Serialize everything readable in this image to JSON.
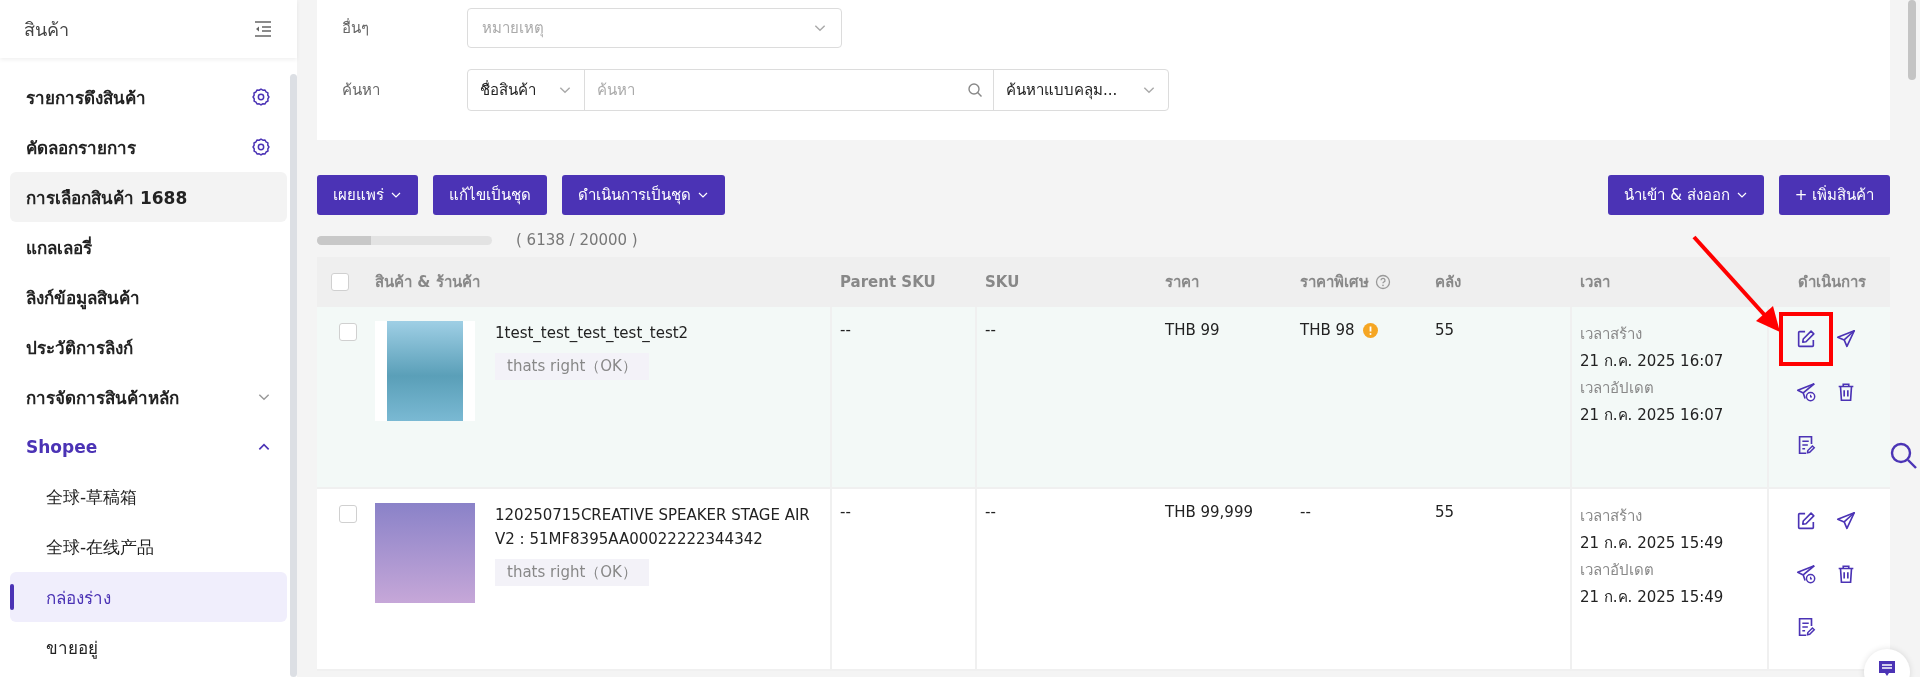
{
  "sidebar": {
    "title": "สินค้า",
    "items": [
      {
        "label": "รายการดึงสินค้า",
        "kind": "settings",
        "selected": false,
        "hovered": false
      },
      {
        "label": "คัดลอกรายการ",
        "kind": "settings",
        "selected": false,
        "hovered": false
      },
      {
        "label": "การเลือกสินค้า 1688",
        "kind": "plain",
        "selected": false,
        "hovered": true
      },
      {
        "label": "แกลเลอรี่",
        "kind": "plain",
        "selected": false,
        "hovered": false
      },
      {
        "label": "ลิงก์ข้อมูลสินค้า",
        "kind": "plain",
        "selected": false,
        "hovered": false
      },
      {
        "label": "ประวัติการลิงก์",
        "kind": "plain",
        "selected": false,
        "hovered": false
      },
      {
        "label": "การจัดการสินค้าหลัก",
        "kind": "group",
        "expanded": false,
        "selected": false,
        "hovered": false
      },
      {
        "label": "Shopee",
        "kind": "group",
        "expanded": true,
        "selected": false,
        "hovered": false
      },
      {
        "label": "全球-草稿箱",
        "kind": "child",
        "selected": false,
        "hovered": false
      },
      {
        "label": "全球-在线产品",
        "kind": "child",
        "selected": false,
        "hovered": false
      },
      {
        "label": "กล่องร่าง",
        "kind": "child",
        "selected": true,
        "hovered": false
      },
      {
        "label": "ขายอยู่",
        "kind": "child",
        "selected": false,
        "hovered": false
      }
    ]
  },
  "filters": {
    "other": {
      "label": "อื่นๆ",
      "placeholder": "หมายเหตุ"
    },
    "search": {
      "label": "ค้นหา",
      "field_select": "ชื่อสินค้า",
      "placeholder": "ค้นหา",
      "mode": "ค้นหาแบบคลุม..."
    }
  },
  "toolbar": {
    "left": [
      {
        "label": "เผยแพร่",
        "dropdown": true
      },
      {
        "label": "แก้ไขเป็นชุด",
        "dropdown": false
      },
      {
        "label": "ดำเนินการเป็นชุด",
        "dropdown": true
      }
    ],
    "right": [
      {
        "label": "นำเข้า & ส่งออก",
        "dropdown": true
      },
      {
        "label": "+ เพิ่มสินค้า",
        "dropdown": false
      }
    ]
  },
  "quota": {
    "level": 0.307,
    "text": "( 6138 / 20000 )"
  },
  "table": {
    "all_checked": false,
    "columns": [
      "สินค้า & ร้านค้า",
      "Parent SKU",
      "SKU",
      "ราคา",
      "ราคาพิเศษ",
      "คลัง",
      "เวลา",
      "ดำเนินการ"
    ],
    "rows": [
      {
        "checked": false,
        "hovered": true,
        "annotated": true,
        "name": "1test_test_test_test_test2",
        "tag": "thats right（OK）",
        "parent_sku": "--",
        "sku": "--",
        "price": "THB 99",
        "special_price": "THB 98",
        "warning": true,
        "stock": "55",
        "created_label": "เวลาสร้าง",
        "created": "21 ก.ค. 2025 16:07",
        "updated_label": "เวลาอัปเดต",
        "updated": "21 ก.ค. 2025 16:07"
      },
      {
        "checked": false,
        "hovered": false,
        "annotated": false,
        "name": "120250715CREATIVE SPEAKER STAGE AIR V2 : 51MF8395AA00022222344342",
        "tag": "thats right（OK）",
        "parent_sku": "--",
        "sku": "--",
        "price": "THB 99,999",
        "special_price": "--",
        "warning": false,
        "stock": "55",
        "created_label": "เวลาสร้าง",
        "created": "21 ก.ค. 2025 15:49",
        "updated_label": "เวลาอัปเดต",
        "updated": "21 ก.ค. 2025 15:49"
      }
    ]
  }
}
